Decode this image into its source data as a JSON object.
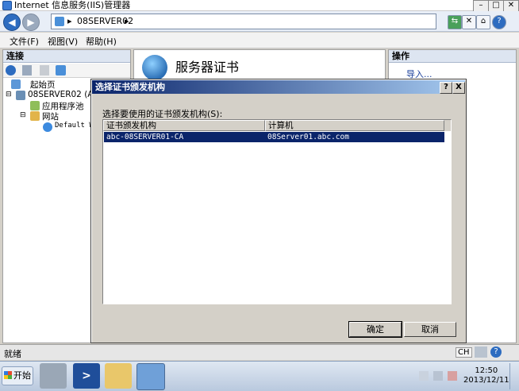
{
  "window": {
    "title": "Internet 信息服务(IIS)管理器"
  },
  "address": {
    "path": "08SERVER02",
    "separator": "▸"
  },
  "menu": [
    "文件(F)",
    "视图(V)",
    "帮助(H)"
  ],
  "connections": {
    "header": "连接",
    "tree": [
      {
        "label": "起始页",
        "level": 0
      },
      {
        "label": "08SERVER02 (ABC\\",
        "level": 0
      },
      {
        "label": "应用程序池",
        "level": 1
      },
      {
        "label": "网站",
        "level": 1
      },
      {
        "label": "Default We",
        "level": 2
      }
    ]
  },
  "center": {
    "title": "服务器证书"
  },
  "actions": {
    "header": "操作",
    "import_link": "导入..."
  },
  "dialog": {
    "title": "选择证书颁发机构",
    "help_btn": "?",
    "close_btn": "X",
    "prompt": "选择要使用的证书颁发机构(S):",
    "columns": [
      "证书颁发机构",
      "计算机"
    ],
    "rows": [
      {
        "authority": "abc-08SERVER01-CA",
        "computer": "08Server01.abc.com",
        "selected": true
      }
    ],
    "ok_label": "确定",
    "cancel_label": "取消"
  },
  "status": {
    "text": "就绪",
    "lang": "CH"
  },
  "taskbar": {
    "start_label": "开始",
    "time": "12:50",
    "date": "2013/12/11"
  },
  "colors": {
    "selection": "#0a246a",
    "dialog_title_start": "#0a246a",
    "link": "#1a3f9b"
  }
}
